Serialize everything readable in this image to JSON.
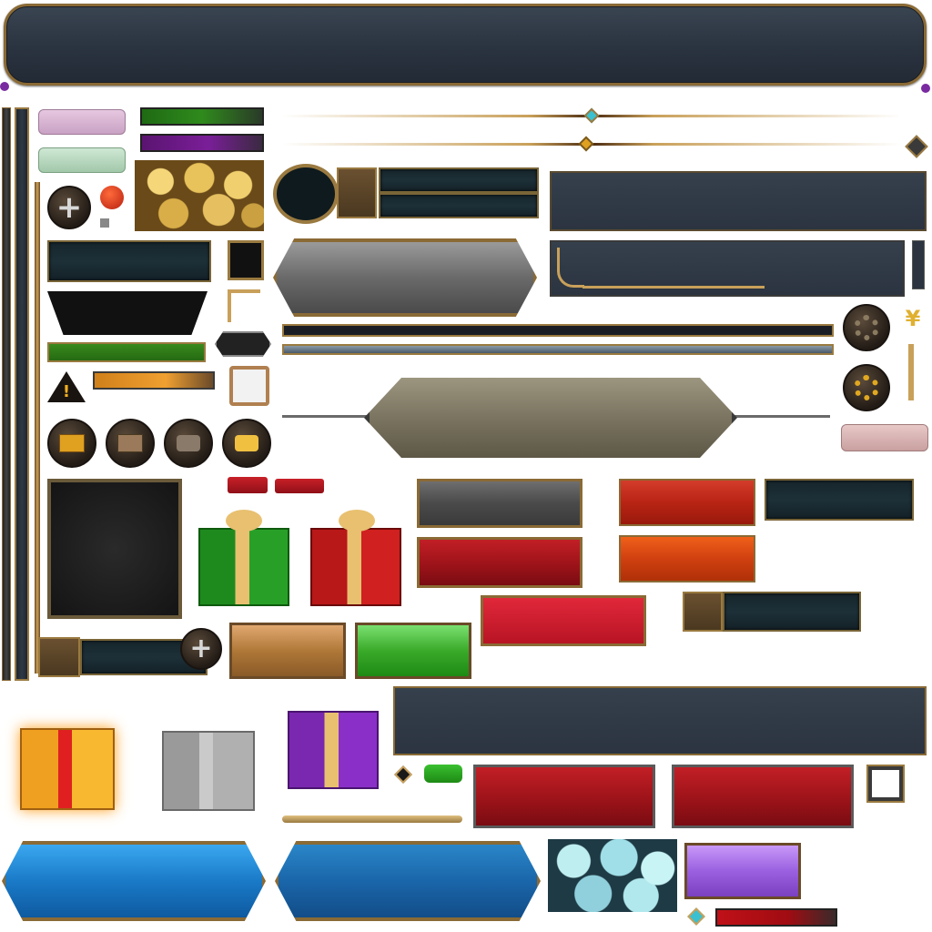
{
  "sheet": {
    "background": "#ffffff",
    "accents": {
      "gold": "#9a7a40",
      "slate": "#2b3440",
      "teal": "#1d3038",
      "red": "#c21f26",
      "blue": "#1a66aa",
      "green": "#2f8a1c",
      "purple": "#7a1e98"
    }
  },
  "icons": {
    "add": "plus-icon",
    "warning": "exclamation-icon",
    "mail": "envelope-icon",
    "chat": "speech-bubble-icon",
    "settings": "gear-icon",
    "currency": "yen-icon",
    "gift": "gift-box-icon",
    "gems": "gems-icon",
    "coins": "coins-icon"
  },
  "glyphs": {
    "plus": "+",
    "warning": "!",
    "yen": "¥"
  },
  "gifts": [
    "green",
    "red",
    "gold",
    "silver",
    "purple"
  ],
  "button_variants": [
    "stone",
    "red",
    "crimson",
    "blue",
    "green",
    "copper",
    "violet",
    "pink"
  ]
}
